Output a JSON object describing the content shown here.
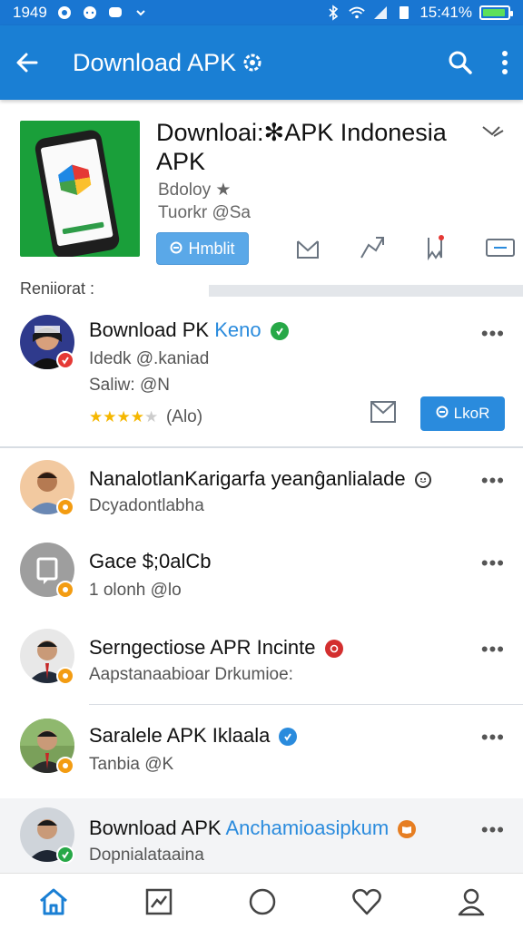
{
  "status_bar": {
    "time": "1949",
    "clock": "15:41%"
  },
  "app_bar": {
    "title": "Download APK"
  },
  "hero": {
    "name": "Downloai:✻APK Indonesia APK",
    "subtitle_1": "Bdoloy ★",
    "subtitle_2": "Tuorkr @Sa",
    "primary_button": "Hmblit"
  },
  "section": {
    "label": "Reniiorat :"
  },
  "featured": {
    "title_prefix": "Bownload PK",
    "title_highlight": "Keno",
    "line1": "Idedk @.kaniad",
    "line2": "Saliw: @N",
    "rating_text": "(Alo)",
    "rating": 4,
    "follow_button": "LkoR"
  },
  "items": [
    {
      "title": "NanalotlanKarigarfa yeanĝanlialade",
      "subtitle": "Dcyadontlabha"
    },
    {
      "title": "Gace $;0alCb",
      "subtitle": "1 olonh @lo"
    },
    {
      "title": "Serngectiose APR Incinte",
      "subtitle": "Aapstanaabioar Drkumioe:"
    },
    {
      "title": "Saralele APK Iklaala",
      "subtitle": "Tanbia @K"
    },
    {
      "title_prefix": "Bownload APK",
      "title_highlight": "Anchamioasipkum",
      "subtitle": "Dopnialataaina"
    }
  ],
  "colors": {
    "primary": "#1a7fd4",
    "accent_green": "#1a9f3a",
    "star": "#f5b700"
  }
}
